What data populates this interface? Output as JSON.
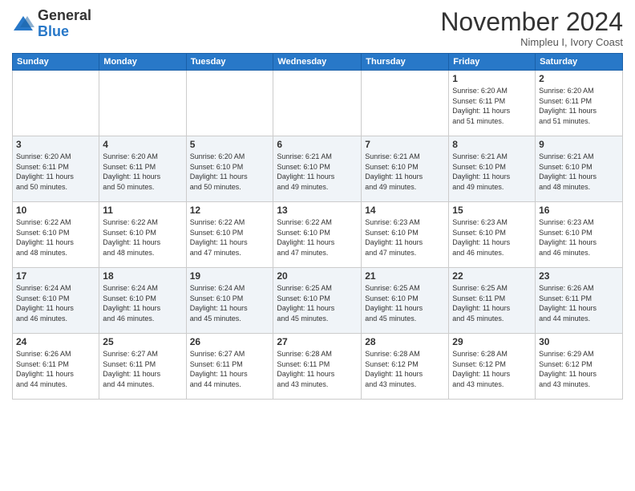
{
  "header": {
    "logo_general": "General",
    "logo_blue": "Blue",
    "month_title": "November 2024",
    "location": "Nimpleu I, Ivory Coast"
  },
  "weekdays": [
    "Sunday",
    "Monday",
    "Tuesday",
    "Wednesday",
    "Thursday",
    "Friday",
    "Saturday"
  ],
  "weeks": [
    [
      {
        "day": "",
        "info": ""
      },
      {
        "day": "",
        "info": ""
      },
      {
        "day": "",
        "info": ""
      },
      {
        "day": "",
        "info": ""
      },
      {
        "day": "",
        "info": ""
      },
      {
        "day": "1",
        "info": "Sunrise: 6:20 AM\nSunset: 6:11 PM\nDaylight: 11 hours\nand 51 minutes."
      },
      {
        "day": "2",
        "info": "Sunrise: 6:20 AM\nSunset: 6:11 PM\nDaylight: 11 hours\nand 51 minutes."
      }
    ],
    [
      {
        "day": "3",
        "info": "Sunrise: 6:20 AM\nSunset: 6:11 PM\nDaylight: 11 hours\nand 50 minutes."
      },
      {
        "day": "4",
        "info": "Sunrise: 6:20 AM\nSunset: 6:11 PM\nDaylight: 11 hours\nand 50 minutes."
      },
      {
        "day": "5",
        "info": "Sunrise: 6:20 AM\nSunset: 6:10 PM\nDaylight: 11 hours\nand 50 minutes."
      },
      {
        "day": "6",
        "info": "Sunrise: 6:21 AM\nSunset: 6:10 PM\nDaylight: 11 hours\nand 49 minutes."
      },
      {
        "day": "7",
        "info": "Sunrise: 6:21 AM\nSunset: 6:10 PM\nDaylight: 11 hours\nand 49 minutes."
      },
      {
        "day": "8",
        "info": "Sunrise: 6:21 AM\nSunset: 6:10 PM\nDaylight: 11 hours\nand 49 minutes."
      },
      {
        "day": "9",
        "info": "Sunrise: 6:21 AM\nSunset: 6:10 PM\nDaylight: 11 hours\nand 48 minutes."
      }
    ],
    [
      {
        "day": "10",
        "info": "Sunrise: 6:22 AM\nSunset: 6:10 PM\nDaylight: 11 hours\nand 48 minutes."
      },
      {
        "day": "11",
        "info": "Sunrise: 6:22 AM\nSunset: 6:10 PM\nDaylight: 11 hours\nand 48 minutes."
      },
      {
        "day": "12",
        "info": "Sunrise: 6:22 AM\nSunset: 6:10 PM\nDaylight: 11 hours\nand 47 minutes."
      },
      {
        "day": "13",
        "info": "Sunrise: 6:22 AM\nSunset: 6:10 PM\nDaylight: 11 hours\nand 47 minutes."
      },
      {
        "day": "14",
        "info": "Sunrise: 6:23 AM\nSunset: 6:10 PM\nDaylight: 11 hours\nand 47 minutes."
      },
      {
        "day": "15",
        "info": "Sunrise: 6:23 AM\nSunset: 6:10 PM\nDaylight: 11 hours\nand 46 minutes."
      },
      {
        "day": "16",
        "info": "Sunrise: 6:23 AM\nSunset: 6:10 PM\nDaylight: 11 hours\nand 46 minutes."
      }
    ],
    [
      {
        "day": "17",
        "info": "Sunrise: 6:24 AM\nSunset: 6:10 PM\nDaylight: 11 hours\nand 46 minutes."
      },
      {
        "day": "18",
        "info": "Sunrise: 6:24 AM\nSunset: 6:10 PM\nDaylight: 11 hours\nand 46 minutes."
      },
      {
        "day": "19",
        "info": "Sunrise: 6:24 AM\nSunset: 6:10 PM\nDaylight: 11 hours\nand 45 minutes."
      },
      {
        "day": "20",
        "info": "Sunrise: 6:25 AM\nSunset: 6:10 PM\nDaylight: 11 hours\nand 45 minutes."
      },
      {
        "day": "21",
        "info": "Sunrise: 6:25 AM\nSunset: 6:10 PM\nDaylight: 11 hours\nand 45 minutes."
      },
      {
        "day": "22",
        "info": "Sunrise: 6:25 AM\nSunset: 6:11 PM\nDaylight: 11 hours\nand 45 minutes."
      },
      {
        "day": "23",
        "info": "Sunrise: 6:26 AM\nSunset: 6:11 PM\nDaylight: 11 hours\nand 44 minutes."
      }
    ],
    [
      {
        "day": "24",
        "info": "Sunrise: 6:26 AM\nSunset: 6:11 PM\nDaylight: 11 hours\nand 44 minutes."
      },
      {
        "day": "25",
        "info": "Sunrise: 6:27 AM\nSunset: 6:11 PM\nDaylight: 11 hours\nand 44 minutes."
      },
      {
        "day": "26",
        "info": "Sunrise: 6:27 AM\nSunset: 6:11 PM\nDaylight: 11 hours\nand 44 minutes."
      },
      {
        "day": "27",
        "info": "Sunrise: 6:28 AM\nSunset: 6:11 PM\nDaylight: 11 hours\nand 43 minutes."
      },
      {
        "day": "28",
        "info": "Sunrise: 6:28 AM\nSunset: 6:12 PM\nDaylight: 11 hours\nand 43 minutes."
      },
      {
        "day": "29",
        "info": "Sunrise: 6:28 AM\nSunset: 6:12 PM\nDaylight: 11 hours\nand 43 minutes."
      },
      {
        "day": "30",
        "info": "Sunrise: 6:29 AM\nSunset: 6:12 PM\nDaylight: 11 hours\nand 43 minutes."
      }
    ]
  ]
}
